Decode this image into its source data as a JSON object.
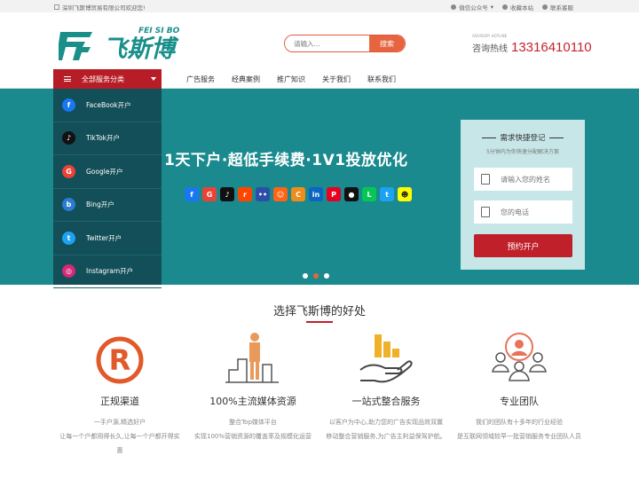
{
  "topbar": {
    "welcome": "深圳飞斯博贸易有限公司欢迎您!",
    "wechat": "微信公众号",
    "bookmark": "收藏本站",
    "service": "联系客服"
  },
  "logo": {
    "text": "飞斯博",
    "latin": "FEI SI BO",
    "mark": "F"
  },
  "search": {
    "placeholder": "请输入...",
    "button": "搜索"
  },
  "hotline": {
    "label": "咨询热线",
    "small": "ADVISORY HOTLINE",
    "number": "13316410110"
  },
  "nav": {
    "category": "全部服务分类",
    "links": [
      "广告服务",
      "经典案例",
      "推广知识",
      "关于我们",
      "联系我们"
    ]
  },
  "sidemenu": [
    {
      "label": "FaceBook开户",
      "icon": "facebook-icon",
      "color": "#1877f2",
      "glyph": "f"
    },
    {
      "label": "TikTok开户",
      "icon": "tiktok-icon",
      "color": "#111111",
      "glyph": "♪"
    },
    {
      "label": "Google开户",
      "icon": "google-icon",
      "color": "#ea4335",
      "glyph": "G"
    },
    {
      "label": "Bing开户",
      "icon": "bing-icon",
      "color": "#2c7cd1",
      "glyph": "b"
    },
    {
      "label": "Twitter开户",
      "icon": "twitter-icon",
      "color": "#1da1f2",
      "glyph": "t"
    },
    {
      "label": "Instagram开户",
      "icon": "instagram-icon",
      "color": "#d62976",
      "glyph": "◎"
    }
  ],
  "banner": {
    "slogan": "1天下户·超低手续费·1V1投放优化",
    "social_icons": [
      {
        "name": "facebook-icon",
        "color": "#1877f2",
        "glyph": "f"
      },
      {
        "name": "google-icon",
        "color": "#ea4335",
        "glyph": "G"
      },
      {
        "name": "tiktok-icon",
        "color": "#111111",
        "glyph": "♪"
      },
      {
        "name": "reddit-icon",
        "color": "#ff4500",
        "glyph": "r"
      },
      {
        "name": "flickr-icon",
        "color": "#2b4fa8",
        "glyph": "••"
      },
      {
        "name": "reddit-alt-icon",
        "color": "#ff6314",
        "glyph": "☺"
      },
      {
        "name": "c-icon",
        "color": "#f08c1a",
        "glyph": "C"
      },
      {
        "name": "linkedin-icon",
        "color": "#0a66c2",
        "glyph": "in"
      },
      {
        "name": "pinterest-icon",
        "color": "#e60023",
        "glyph": "P"
      },
      {
        "name": "apple-icon",
        "color": "#111111",
        "glyph": "●"
      },
      {
        "name": "line-icon",
        "color": "#06c755",
        "glyph": "L"
      },
      {
        "name": "twitter-icon",
        "color": "#1da1f2",
        "glyph": "t"
      },
      {
        "name": "snapchat-icon",
        "color": "#fffc00",
        "glyph": "☻"
      }
    ],
    "slides": 3,
    "active_slide": 2
  },
  "form": {
    "title": "需求快捷登记",
    "subtitle": "5分钟内为你快速分配解决方案",
    "name_placeholder": "请输入您的姓名",
    "phone_placeholder": "您的电话",
    "submit": "预约开户"
  },
  "benefits": {
    "title": "选择飞斯博的好处",
    "items": [
      {
        "title": "正规渠道",
        "lines": [
          "一手户源,精选好户",
          "让每一个户都用得长久,让每一个户都开得实惠"
        ]
      },
      {
        "title": "100%主流媒体资源",
        "lines": [
          "整合Top媒体平台",
          "实现100%营销资源的覆盖率及规模化运营"
        ]
      },
      {
        "title": "一站式整合服务",
        "lines": [
          "以客户为中心,助力您的广告实现品效双赢",
          "移动整合营销服务,为广告主利益保驾护航。"
        ]
      },
      {
        "title": "专业团队",
        "lines": [
          "我们的团队有十多年的行业经验",
          "是互联网领域较早一批营销服务专业团队人员"
        ]
      }
    ]
  },
  "colors": {
    "brand_red": "#c0202a",
    "teal": "#1b8a8e",
    "dark_teal": "#134f58",
    "logo_green": "#1a8f8a",
    "orange": "#e6643f"
  }
}
